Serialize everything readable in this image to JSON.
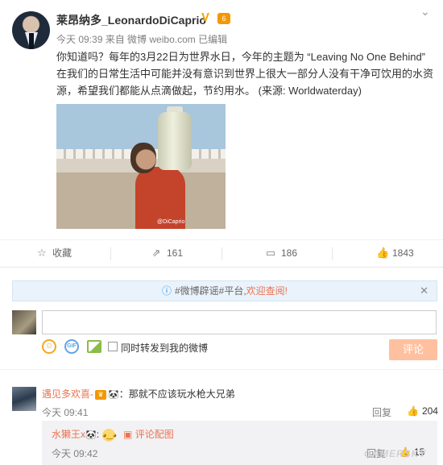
{
  "post": {
    "username": "莱昂纳多_LeonardoDiCaprio",
    "verified_icon": "V",
    "level_badge": "6",
    "meta_time": "今天 09:39",
    "meta_from": "来自 微博 weibo.com",
    "meta_edited": "已编辑",
    "text": "你知道吗？每年的3月22日为世界水日，今年的主题为 “Leaving No One Behind” 在我们的日常生活中可能并没有意识到世界上很大一部分人没有干净可饮用的水资源，希望我们都能从点滴做起，节约用水。 (来源: Worldwaterday)",
    "image_watermark": "@DiCaprio"
  },
  "actions": {
    "favorite_label": "收藏",
    "repost_count": "161",
    "comment_count": "186",
    "like_count": "1843"
  },
  "comments": {
    "notice_prefix": "#微博辟谣#平台,",
    "notice_link": "欢迎查阅!",
    "repost_option": "同时转发到我的微博",
    "submit_label": "评论",
    "items": [
      {
        "user": "遇见多欢喜-",
        "text": "：那就不应该玩水枪大兄弟",
        "time": "今天 09:41",
        "reply_label": "回复",
        "likes": "204",
        "replies": [
          {
            "user": "水獭王x",
            "comment_image_label": "评论配图",
            "time": "今天 09:42",
            "reply_label": "回复",
            "likes": "15"
          }
        ]
      }
    ]
  },
  "watermark": "GAMERSKY",
  "icons": {
    "more": "chevron-down-icon",
    "favorite": "star-icon",
    "repost": "repost-icon",
    "comment": "comment-icon",
    "like": "thumb-up-icon",
    "info": "info-icon",
    "close": "close-icon"
  },
  "colors": {
    "accent": "#eb7350",
    "link_blue": "#2c8fe0",
    "submit_disabled": "#ffc09f",
    "verified": "#f7a400"
  }
}
